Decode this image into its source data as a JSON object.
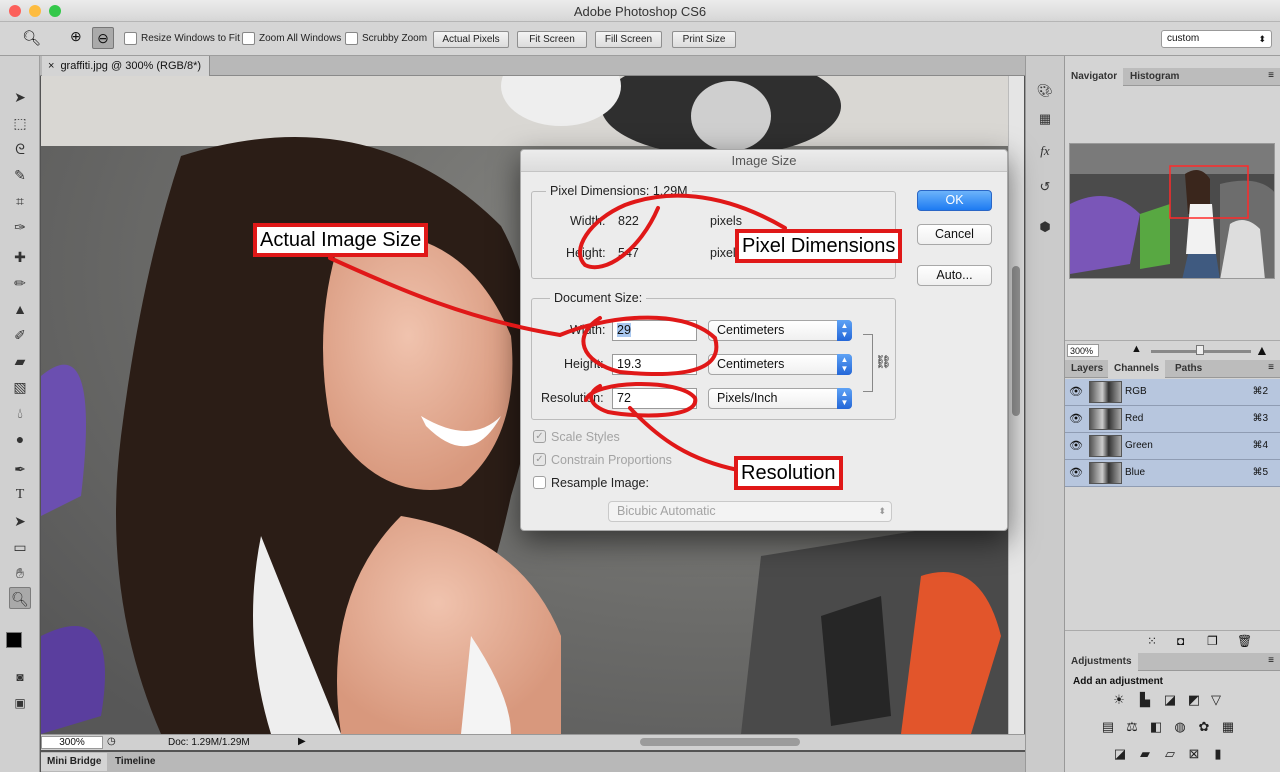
{
  "window": {
    "title": "Adobe Photoshop CS6"
  },
  "options": {
    "resize_windows_label": "Resize Windows to Fit",
    "zoom_all_label": "Zoom All Windows",
    "scrubby_label": "Scrubby Zoom",
    "actual_pixels": "Actual Pixels",
    "fit_screen": "Fit Screen",
    "fill_screen": "Fill Screen",
    "print_size": "Print Size",
    "workspace": "custom"
  },
  "document": {
    "tab_title": "graffiti.jpg @ 300% (RGB/8*)",
    "zoom": "300%",
    "doc_size": "Doc: 1.29M/1.29M"
  },
  "bottom_tabs": [
    "Mini Bridge",
    "Timeline"
  ],
  "navigator": {
    "tabs": [
      "Navigator",
      "Histogram"
    ],
    "zoom": "300%"
  },
  "channels": {
    "tabs": [
      "Layers",
      "Channels",
      "Paths"
    ],
    "rows": [
      {
        "name": "RGB",
        "shortcut": "⌘2"
      },
      {
        "name": "Red",
        "shortcut": "⌘3"
      },
      {
        "name": "Green",
        "shortcut": "⌘4"
      },
      {
        "name": "Blue",
        "shortcut": "⌘5"
      }
    ]
  },
  "adjustments": {
    "tab": "Adjustments",
    "subtitle": "Add an adjustment"
  },
  "dialog": {
    "title": "Image Size",
    "pixel_dimensions": {
      "legend": "Pixel Dimensions:  1.29M",
      "width_label": "Width:",
      "width_value": "822",
      "width_unit": "pixels",
      "height_label": "Height:",
      "height_value": "547",
      "height_unit": "pixels"
    },
    "document_size": {
      "legend": "Document Size:",
      "width_label": "Width:",
      "width_value": "29",
      "width_unit": "Centimeters",
      "height_label": "Height:",
      "height_value": "19.3",
      "height_unit": "Centimeters",
      "resolution_label": "Resolution:",
      "resolution_value": "72",
      "resolution_unit": "Pixels/Inch"
    },
    "scale_styles": "Scale Styles",
    "constrain": "Constrain Proportions",
    "resample": "Resample Image:",
    "resample_method": "Bicubic Automatic",
    "ok": "OK",
    "cancel": "Cancel",
    "auto": "Auto..."
  },
  "annotations": {
    "actual": "Actual Image Size",
    "pixel_dims": "Pixel Dimensions",
    "resolution": "Resolution"
  },
  "colors": {
    "annotation": "#e01818",
    "ok_button": "#1d7af2",
    "channel_row": "#b7c6de"
  }
}
